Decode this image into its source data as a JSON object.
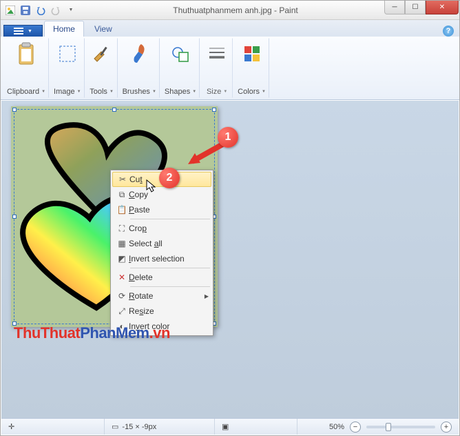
{
  "title": "Thuthuatphanmem anh.jpg - Paint",
  "tabs": {
    "file": "",
    "home": "Home",
    "view": "View"
  },
  "ribbon": {
    "clipboard": "Clipboard",
    "image": "Image",
    "tools": "Tools",
    "brushes": "Brushes",
    "shapes": "Shapes",
    "size": "Size",
    "colors": "Colors"
  },
  "context": {
    "cut": "Cut",
    "cut_mn": "t",
    "copy": "Copy",
    "copy_mn": "C",
    "paste": "Paste",
    "paste_mn": "P",
    "crop": "Crop",
    "crop_mn": "p",
    "selectall": "Select all",
    "selectall_mn": "a",
    "invertsel": "Invert selection",
    "invertsel_mn": "I",
    "delete": "Delete",
    "delete_mn": "D",
    "rotate": "Rotate",
    "rotate_mn": "R",
    "resize": "Resize",
    "resize_mn": "s",
    "invertcolor": "Invert color",
    "invertcolor_mn": "v"
  },
  "markers": {
    "one": "1",
    "two": "2"
  },
  "watermark": {
    "a": "ThuThuat",
    "b": "PhanMem",
    "c": ".vn"
  },
  "status": {
    "coords": "-15 × -9px",
    "zoom": "50%"
  }
}
